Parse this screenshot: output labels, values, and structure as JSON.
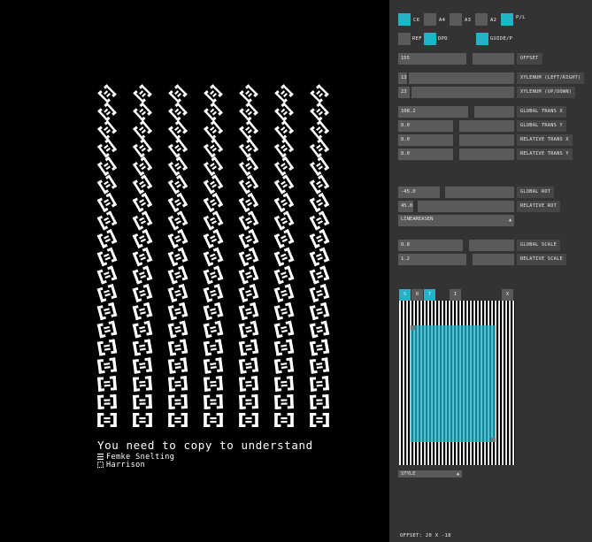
{
  "canvas": {
    "caption": "You need to copy to understand",
    "credits": [
      "Femke Snelting",
      "Harrison"
    ],
    "columns": 7,
    "rows": 19
  },
  "panel": {
    "toggles": [
      {
        "label": "C6",
        "on": true
      },
      {
        "label": "A4",
        "on": false
      },
      {
        "label": "A3",
        "on": false
      },
      {
        "label": "A2",
        "on": false
      },
      {
        "label": "P/L",
        "on": true
      }
    ],
    "options": [
      {
        "label": "REF",
        "on": false
      },
      {
        "label": "DPD",
        "on": true
      },
      {
        "label": "GUIDE/P",
        "on": true
      }
    ],
    "offset": {
      "value": "155",
      "label": "OFFSET"
    },
    "xyl_lr": {
      "value": "13",
      "label": "XYLENUM (LEFT/RIGHT)"
    },
    "xyl_ud": {
      "value": "23",
      "label": "XYLENUM (UP/DOWN)"
    },
    "global_trans_x": {
      "value": "108.2",
      "label": "GLOBAL TRANS X"
    },
    "global_trans_y": {
      "value": "0.0",
      "label": "GLOBAL TRANS Y"
    },
    "relative_trans_x": {
      "value": "0.0",
      "label": "RELATIVE TRANS X"
    },
    "relative_trans_y": {
      "value": "0.0",
      "label": "RELATIVE TRANS Y"
    },
    "global_rot": {
      "value": "-45.0",
      "label": "GLOBAL ROT"
    },
    "relative_rot": {
      "value": "45.0",
      "label": "RELATIVE ROT"
    },
    "easing": {
      "value": "LINEAREASEN"
    },
    "global_scale": {
      "value": "0.8",
      "label": "GLOBAL SCALE"
    },
    "relative_scale": {
      "value": "1.2",
      "label": "RELATIVE SCALE"
    },
    "tabs": [
      {
        "label": "S",
        "on": true
      },
      {
        "label": "R",
        "on": false
      },
      {
        "label": "T",
        "on": true
      },
      {
        "label": "I",
        "on": false
      },
      {
        "label": "X",
        "on": false
      }
    ],
    "style": {
      "value": "STYLE"
    },
    "status": "OFFSET: 20 X -18"
  },
  "colors": {
    "accent": "#1fb5c9",
    "panel": "#333333",
    "field": "#5a5a5a"
  }
}
